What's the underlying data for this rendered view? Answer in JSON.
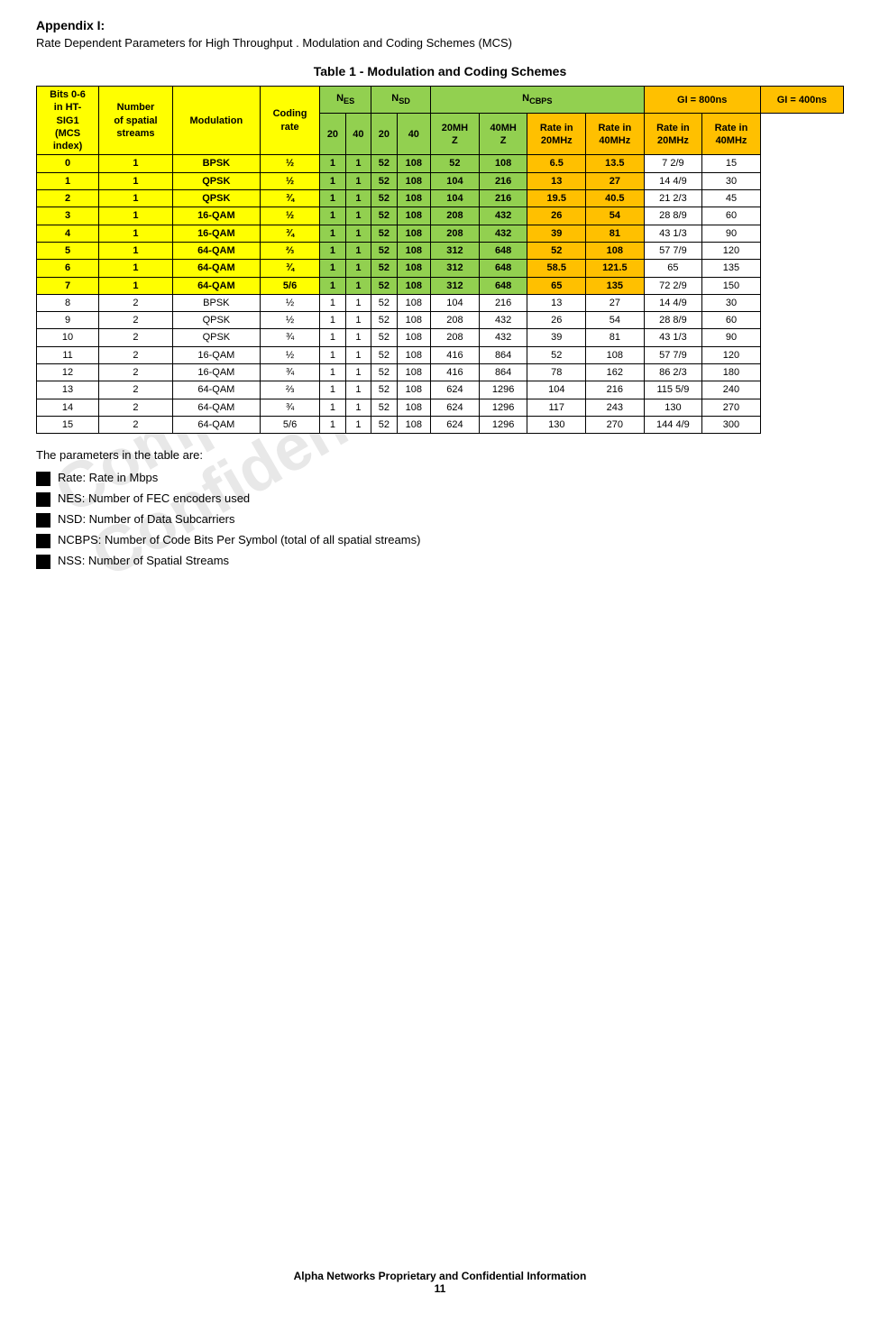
{
  "page": {
    "appendix_title": "Appendix I:",
    "appendix_subtitle": "Rate Dependent Parameters for High Throughput . Modulation and Coding Schemes (MCS)",
    "table_title": "Table 1 - Modulation and Coding Schemes",
    "params_intro": "The parameters in the table are:",
    "params": [
      "Rate: Rate in Mbps",
      "NES: Number of FEC encoders used",
      "NSD: Number of Data Subcarriers",
      "NCBPS: Number of Code Bits Per Symbol (total of all spatial streams)",
      "NSS: Number of  Spatial Streams"
    ],
    "footer_text": "Alpha Networks Proprietary and Confidential Information",
    "footer_page": "11",
    "watermark": "Company Confidential"
  },
  "table": {
    "rows": [
      {
        "bits": "0",
        "nss": "1",
        "mod": "BPSK",
        "cr": "½",
        "nes20": "1",
        "nes40": "1",
        "nsd20": "52",
        "nsd40": "108",
        "ncbps20mhz": "52",
        "ncbps40mhz": "108",
        "gi800_20": "6.5",
        "gi800_40": "13.5",
        "gi400_20": "7 2/9",
        "gi400_40": "15"
      },
      {
        "bits": "1",
        "nss": "1",
        "mod": "QPSK",
        "cr": "½",
        "nes20": "1",
        "nes40": "1",
        "nsd20": "52",
        "nsd40": "108",
        "ncbps20mhz": "104",
        "ncbps40mhz": "216",
        "gi800_20": "13",
        "gi800_40": "27",
        "gi400_20": "14 4/9",
        "gi400_40": "30"
      },
      {
        "bits": "2",
        "nss": "1",
        "mod": "QPSK",
        "cr": "¾",
        "nes20": "1",
        "nes40": "1",
        "nsd20": "52",
        "nsd40": "108",
        "ncbps20mhz": "104",
        "ncbps40mhz": "216",
        "gi800_20": "19.5",
        "gi800_40": "40.5",
        "gi400_20": "21 2/3",
        "gi400_40": "45"
      },
      {
        "bits": "3",
        "nss": "1",
        "mod": "16-QAM",
        "cr": "½",
        "nes20": "1",
        "nes40": "1",
        "nsd20": "52",
        "nsd40": "108",
        "ncbps20mhz": "208",
        "ncbps40mhz": "432",
        "gi800_20": "26",
        "gi800_40": "54",
        "gi400_20": "28 8/9",
        "gi400_40": "60"
      },
      {
        "bits": "4",
        "nss": "1",
        "mod": "16-QAM",
        "cr": "¾",
        "nes20": "1",
        "nes40": "1",
        "nsd20": "52",
        "nsd40": "108",
        "ncbps20mhz": "208",
        "ncbps40mhz": "432",
        "gi800_20": "39",
        "gi800_40": "81",
        "gi400_20": "43 1/3",
        "gi400_40": "90"
      },
      {
        "bits": "5",
        "nss": "1",
        "mod": "64-QAM",
        "cr": "⅔",
        "nes20": "1",
        "nes40": "1",
        "nsd20": "52",
        "nsd40": "108",
        "ncbps20mhz": "312",
        "ncbps40mhz": "648",
        "gi800_20": "52",
        "gi800_40": "108",
        "gi400_20": "57 7/9",
        "gi400_40": "120"
      },
      {
        "bits": "6",
        "nss": "1",
        "mod": "64-QAM",
        "cr": "¾",
        "nes20": "1",
        "nes40": "1",
        "nsd20": "52",
        "nsd40": "108",
        "ncbps20mhz": "312",
        "ncbps40mhz": "648",
        "gi800_20": "58.5",
        "gi800_40": "121.5",
        "gi400_20": "65",
        "gi400_40": "135"
      },
      {
        "bits": "7",
        "nss": "1",
        "mod": "64-QAM",
        "cr": "5/6",
        "nes20": "1",
        "nes40": "1",
        "nsd20": "52",
        "nsd40": "108",
        "ncbps20mhz": "312",
        "ncbps40mhz": "648",
        "gi800_20": "65",
        "gi800_40": "135",
        "gi400_20": "72 2/9",
        "gi400_40": "150"
      },
      {
        "bits": "8",
        "nss": "2",
        "mod": "BPSK",
        "cr": "½",
        "nes20": "1",
        "nes40": "1",
        "nsd20": "52",
        "nsd40": "108",
        "ncbps20mhz": "104",
        "ncbps40mhz": "216",
        "gi800_20": "13",
        "gi800_40": "27",
        "gi400_20": "14 4/9",
        "gi400_40": "30"
      },
      {
        "bits": "9",
        "nss": "2",
        "mod": "QPSK",
        "cr": "½",
        "nes20": "1",
        "nes40": "1",
        "nsd20": "52",
        "nsd40": "108",
        "ncbps20mhz": "208",
        "ncbps40mhz": "432",
        "gi800_20": "26",
        "gi800_40": "54",
        "gi400_20": "28 8/9",
        "gi400_40": "60"
      },
      {
        "bits": "10",
        "nss": "2",
        "mod": "QPSK",
        "cr": "¾",
        "nes20": "1",
        "nes40": "1",
        "nsd20": "52",
        "nsd40": "108",
        "ncbps20mhz": "208",
        "ncbps40mhz": "432",
        "gi800_20": "39",
        "gi800_40": "81",
        "gi400_20": "43 1/3",
        "gi400_40": "90"
      },
      {
        "bits": "11",
        "nss": "2",
        "mod": "16-QAM",
        "cr": "½",
        "nes20": "1",
        "nes40": "1",
        "nsd20": "52",
        "nsd40": "108",
        "ncbps20mhz": "416",
        "ncbps40mhz": "864",
        "gi800_20": "52",
        "gi800_40": "108",
        "gi400_20": "57 7/9",
        "gi400_40": "120"
      },
      {
        "bits": "12",
        "nss": "2",
        "mod": "16-QAM",
        "cr": "¾",
        "nes20": "1",
        "nes40": "1",
        "nsd20": "52",
        "nsd40": "108",
        "ncbps20mhz": "416",
        "ncbps40mhz": "864",
        "gi800_20": "78",
        "gi800_40": "162",
        "gi400_20": "86 2/3",
        "gi400_40": "180"
      },
      {
        "bits": "13",
        "nss": "2",
        "mod": "64-QAM",
        "cr": "⅔",
        "nes20": "1",
        "nes40": "1",
        "nsd20": "52",
        "nsd40": "108",
        "ncbps20mhz": "624",
        "ncbps40mhz": "1296",
        "gi800_20": "104",
        "gi800_40": "216",
        "gi400_20": "115 5/9",
        "gi400_40": "240"
      },
      {
        "bits": "14",
        "nss": "2",
        "mod": "64-QAM",
        "cr": "¾",
        "nes20": "1",
        "nes40": "1",
        "nsd20": "52",
        "nsd40": "108",
        "ncbps20mhz": "624",
        "ncbps40mhz": "1296",
        "gi800_20": "117",
        "gi800_40": "243",
        "gi400_20": "130",
        "gi400_40": "270"
      },
      {
        "bits": "15",
        "nss": "2",
        "mod": "64-QAM",
        "cr": "5/6",
        "nes20": "1",
        "nes40": "1",
        "nsd20": "52",
        "nsd40": "108",
        "ncbps20mhz": "624",
        "ncbps40mhz": "1296",
        "gi800_20": "130",
        "gi800_40": "270",
        "gi400_20": "144 4/9",
        "gi400_40": "300"
      }
    ]
  }
}
